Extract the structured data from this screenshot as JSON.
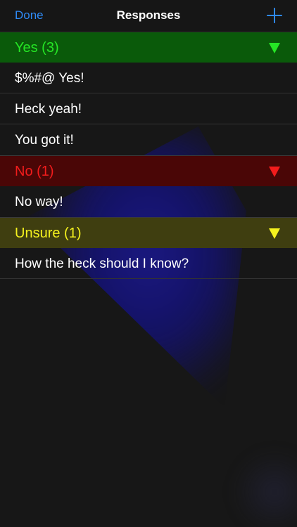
{
  "navbar": {
    "done_label": "Done",
    "title": "Responses",
    "add_icon": "plus-icon"
  },
  "sections": [
    {
      "title": "Yes (3)",
      "color": "#25e625",
      "background": "#0a5a0a",
      "items": [
        "$%#@ Yes!",
        "Heck yeah!",
        "You got it!"
      ]
    },
    {
      "title": "No (1)",
      "color": "#f21c1c",
      "background": "#4a0606",
      "items": [
        "No way!"
      ]
    },
    {
      "title": "Unsure (1)",
      "color": "#f5f21e",
      "background": "#3f3e10",
      "items": [
        "How the heck should I know?"
      ]
    }
  ],
  "colors": {
    "accent": "#2f8af5",
    "background": "#171717"
  }
}
